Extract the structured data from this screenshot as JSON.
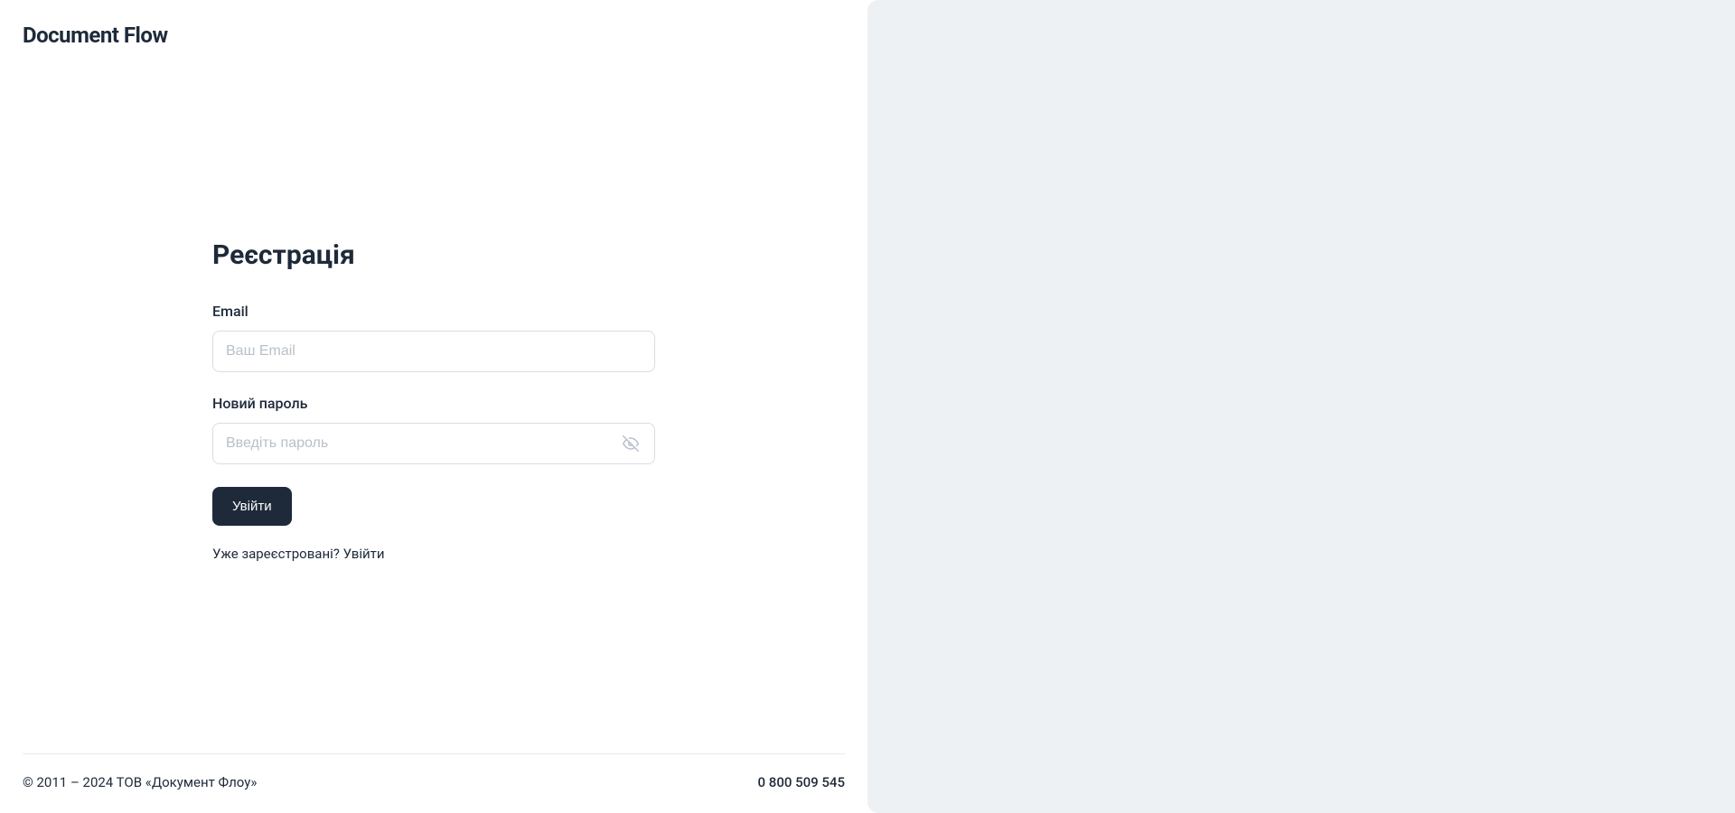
{
  "header": {
    "logo": "Document Flow"
  },
  "form": {
    "title": "Реєстрація",
    "email": {
      "label": "Email",
      "placeholder": "Ваш Email"
    },
    "password": {
      "label": "Новий пароль",
      "placeholder": "Введіть пароль"
    },
    "submit_label": "Увійти",
    "login_prompt": "Уже зареєстровані? ",
    "login_link": "Увійти"
  },
  "footer": {
    "copyright": "© 2011 – 2024 ТОВ «Документ Флоу»",
    "phone": "0 800 509 545"
  }
}
